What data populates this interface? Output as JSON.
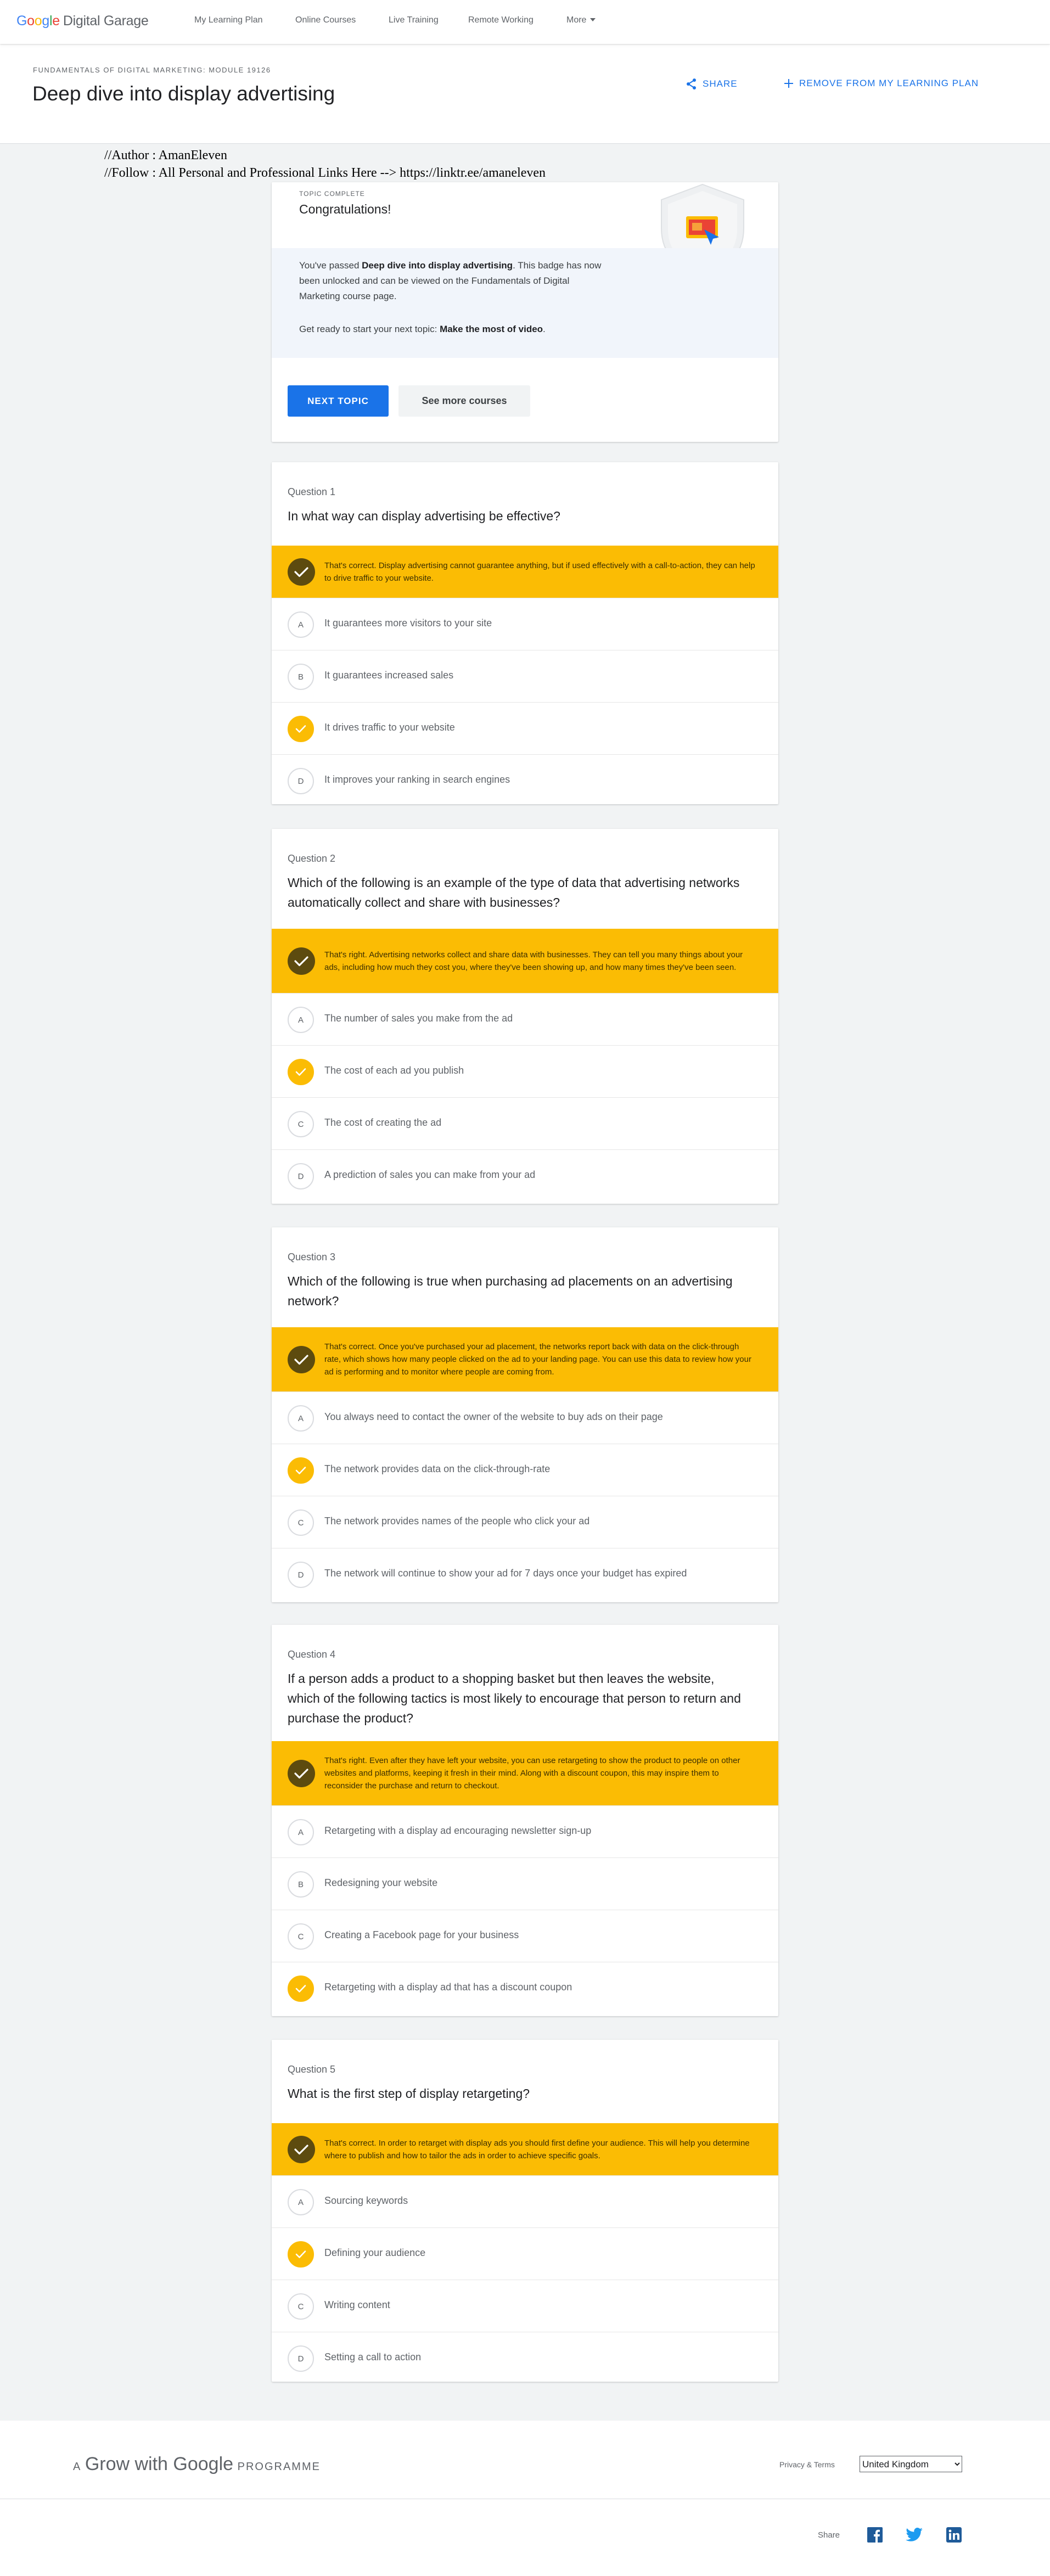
{
  "topbar": {
    "logo": {
      "google": "Google",
      "rest": "Digital Garage"
    },
    "nav": [
      "My Learning Plan",
      "Online Courses",
      "Live Training",
      "Remote Working",
      "More"
    ]
  },
  "header": {
    "module": "FUNDAMENTALS OF DIGITAL MARKETING: MODULE 19126",
    "title": "Deep dive into display advertising",
    "share": "SHARE",
    "remove": "REMOVE FROM MY LEARNING PLAN"
  },
  "author": {
    "line1": "//Author : AmanEleven",
    "line2": "//Follow : All Personal and Professional Links Here -->  https://linktr.ee/amaneleven"
  },
  "topic": {
    "label": "TOPIC COMPLETE",
    "title": "Congratulations!",
    "p1_a": "You've passed ",
    "p1_b": "Deep dive into display advertising",
    "p1_c": ". This badge has now been unlocked and can be viewed on the Fundamentals of Digital Marketing course page.",
    "p2_a": "Get ready to start your next topic: ",
    "p2_b": "Make the most of video",
    "p2_c": ".",
    "next_btn": "NEXT TOPIC",
    "more_btn": "See more courses"
  },
  "questions": [
    {
      "label": "Question 1",
      "text": "In what way can display advertising be effective?",
      "feedback": "That's correct. Display advertising cannot guarantee anything, but if used effectively with a call-to-action, they can help to drive traffic to your website.",
      "options": [
        {
          "letter": "A",
          "text": "It guarantees more visitors to your site",
          "selected": false
        },
        {
          "letter": "B",
          "text": "It guarantees increased sales",
          "selected": false
        },
        {
          "letter": "C",
          "text": "It drives traffic to your website",
          "selected": true
        },
        {
          "letter": "D",
          "text": "It improves your ranking in search engines",
          "selected": false
        }
      ]
    },
    {
      "label": "Question 2",
      "text": "Which of the following is an example of the type of data that advertising networks automatically collect and share with businesses?",
      "feedback": "That's right. Advertising networks collect and share data with businesses. They can tell you many things about your ads, including how much they cost you, where they've been showing up, and how many times they've been seen.",
      "options": [
        {
          "letter": "A",
          "text": "The number of sales you make from the ad",
          "selected": false
        },
        {
          "letter": "B",
          "text": "The cost of each ad you publish",
          "selected": true
        },
        {
          "letter": "C",
          "text": "The cost of creating the ad",
          "selected": false
        },
        {
          "letter": "D",
          "text": "A prediction of sales you can make from your ad",
          "selected": false
        }
      ]
    },
    {
      "label": "Question 3",
      "text": "Which of the following is true when purchasing ad placements on an advertising network?",
      "feedback": "That's correct. Once you've purchased your ad placement, the networks report back with data on the click-through rate, which shows how many people clicked on the ad to your landing page. You can use this data to review how your ad is performing and to monitor where people are coming from.",
      "options": [
        {
          "letter": "A",
          "text": "You always need to contact the owner of the website to buy ads on their page",
          "selected": false
        },
        {
          "letter": "B",
          "text": "The network provides data on the click-through-rate",
          "selected": true
        },
        {
          "letter": "C",
          "text": "The network provides names of the people who click your ad",
          "selected": false
        },
        {
          "letter": "D",
          "text": "The network will continue to show your ad for 7 days once your budget has expired",
          "selected": false
        }
      ]
    },
    {
      "label": "Question 4",
      "text": "If a person adds a product to a shopping basket but then leaves the website, which of the following tactics is most likely to encourage that person to return and purchase the product?",
      "feedback": "That's right. Even after they have left your website, you can use retargeting to show the product to people on other websites and platforms, keeping it fresh in their mind. Along with a discount coupon, this may inspire them to reconsider the purchase and return to checkout.",
      "options": [
        {
          "letter": "A",
          "text": "Retargeting with a display ad encouraging newsletter sign-up",
          "selected": false
        },
        {
          "letter": "B",
          "text": "Redesigning your website",
          "selected": false
        },
        {
          "letter": "C",
          "text": "Creating a Facebook page for your business",
          "selected": false
        },
        {
          "letter": "D",
          "text": "Retargeting with a display ad that has a discount coupon",
          "selected": true
        }
      ]
    },
    {
      "label": "Question 5",
      "text": "What is the first step of display retargeting?",
      "feedback": "That's correct. In order to retarget with display ads you should first define your audience. This will help you determine where to publish and how to tailor the ads in order to achieve specific goals.",
      "options": [
        {
          "letter": "A",
          "text": "Sourcing keywords",
          "selected": false
        },
        {
          "letter": "B",
          "text": "Defining your audience",
          "selected": true
        },
        {
          "letter": "C",
          "text": "Writing content",
          "selected": false
        },
        {
          "letter": "D",
          "text": "Setting a call to action",
          "selected": false
        }
      ]
    }
  ],
  "footer": {
    "logo_a": "A",
    "logo_b": "Grow with Google",
    "logo_c": "PROGRAMME",
    "privacy": "Privacy & Terms",
    "region": "United Kingdom",
    "share": "Share"
  },
  "colors": {
    "accent": "#1a73e8",
    "correct": "#fbbc04",
    "correct_dark": "#5d4b0f"
  }
}
